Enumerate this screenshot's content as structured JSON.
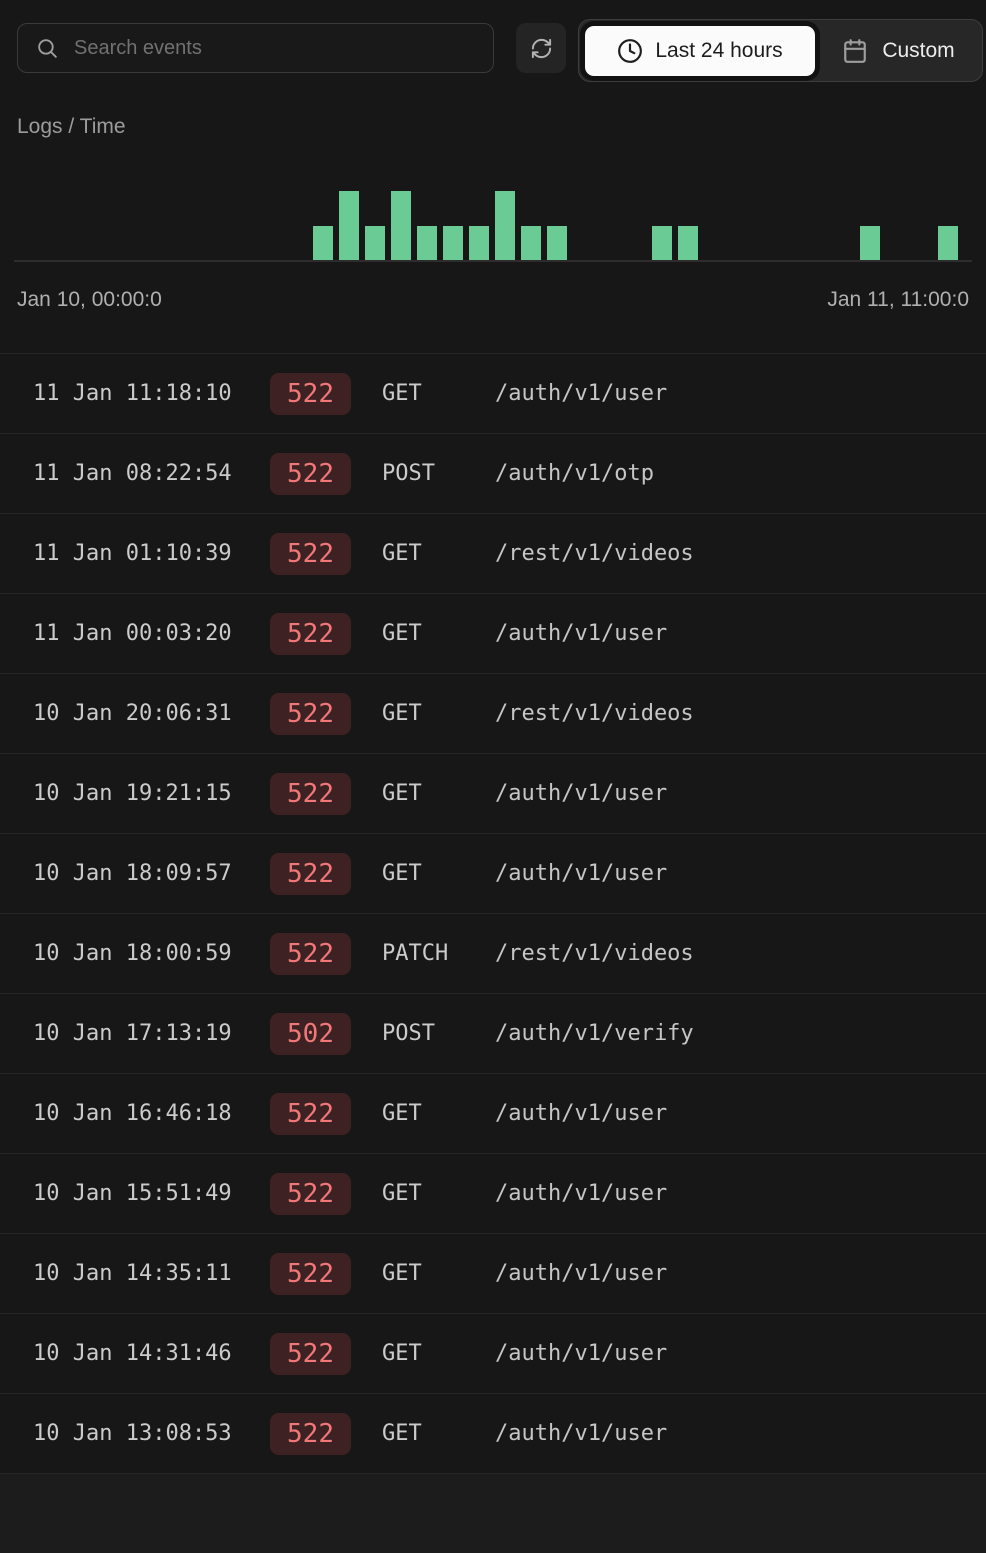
{
  "header": {
    "search": {
      "placeholder": "Search events",
      "value": "",
      "icon": "search-icon"
    },
    "refresh": {
      "icon": "refresh-icon"
    },
    "time_range": {
      "selected": {
        "label": "Last 24 hours",
        "icon": "clock-icon"
      },
      "custom": {
        "label": "Custom",
        "icon": "calendar-icon"
      }
    }
  },
  "chart": {
    "title": "Logs / Time",
    "x_start_label": "Jan 10, 00:00:0",
    "x_end_label": "Jan 11, 11:00:0"
  },
  "chart_data": {
    "type": "bar",
    "title": "Logs / Time",
    "bucket": "1 hour",
    "xlabel": "Time",
    "ylabel": "Logs",
    "ylim": [
      0,
      2
    ],
    "grid": false,
    "bar_color": "#6bcb95",
    "x_axis_labels": [
      "Jan 10, 00:00:0",
      "Jan 11, 11:00:0"
    ],
    "categories": [
      "Jan 10 00:00",
      "Jan 10 01:00",
      "Jan 10 02:00",
      "Jan 10 03:00",
      "Jan 10 04:00",
      "Jan 10 05:00",
      "Jan 10 06:00",
      "Jan 10 07:00",
      "Jan 10 08:00",
      "Jan 10 09:00",
      "Jan 10 10:00",
      "Jan 10 11:00",
      "Jan 10 12:00",
      "Jan 10 13:00",
      "Jan 10 14:00",
      "Jan 10 15:00",
      "Jan 10 16:00",
      "Jan 10 17:00",
      "Jan 10 18:00",
      "Jan 10 19:00",
      "Jan 10 20:00",
      "Jan 10 21:00",
      "Jan 10 22:00",
      "Jan 10 23:00",
      "Jan 11 00:00",
      "Jan 11 01:00",
      "Jan 11 02:00",
      "Jan 11 03:00",
      "Jan 11 04:00",
      "Jan 11 05:00",
      "Jan 11 06:00",
      "Jan 11 07:00",
      "Jan 11 08:00",
      "Jan 11 09:00",
      "Jan 11 10:00",
      "Jan 11 11:00"
    ],
    "values": [
      0,
      0,
      0,
      0,
      0,
      0,
      0,
      0,
      0,
      0,
      0,
      1,
      2,
      1,
      2,
      1,
      1,
      1,
      2,
      1,
      1,
      0,
      0,
      0,
      1,
      1,
      0,
      0,
      0,
      0,
      0,
      0,
      1,
      0,
      0,
      1
    ]
  },
  "table": {
    "rows": [
      {
        "timestamp": "11 Jan 11:18:10",
        "status": "522",
        "method": "GET",
        "path": "/auth/v1/user"
      },
      {
        "timestamp": "11 Jan 08:22:54",
        "status": "522",
        "method": "POST",
        "path": "/auth/v1/otp"
      },
      {
        "timestamp": "11 Jan 01:10:39",
        "status": "522",
        "method": "GET",
        "path": "/rest/v1/videos"
      },
      {
        "timestamp": "11 Jan 00:03:20",
        "status": "522",
        "method": "GET",
        "path": "/auth/v1/user"
      },
      {
        "timestamp": "10 Jan 20:06:31",
        "status": "522",
        "method": "GET",
        "path": "/rest/v1/videos"
      },
      {
        "timestamp": "10 Jan 19:21:15",
        "status": "522",
        "method": "GET",
        "path": "/auth/v1/user"
      },
      {
        "timestamp": "10 Jan 18:09:57",
        "status": "522",
        "method": "GET",
        "path": "/auth/v1/user"
      },
      {
        "timestamp": "10 Jan 18:00:59",
        "status": "522",
        "method": "PATCH",
        "path": "/rest/v1/videos"
      },
      {
        "timestamp": "10 Jan 17:13:19",
        "status": "502",
        "method": "POST",
        "path": "/auth/v1/verify"
      },
      {
        "timestamp": "10 Jan 16:46:18",
        "status": "522",
        "method": "GET",
        "path": "/auth/v1/user"
      },
      {
        "timestamp": "10 Jan 15:51:49",
        "status": "522",
        "method": "GET",
        "path": "/auth/v1/user"
      },
      {
        "timestamp": "10 Jan 14:35:11",
        "status": "522",
        "method": "GET",
        "path": "/auth/v1/user"
      },
      {
        "timestamp": "10 Jan 14:31:46",
        "status": "522",
        "method": "GET",
        "path": "/auth/v1/user"
      },
      {
        "timestamp": "10 Jan 13:08:53",
        "status": "522",
        "method": "GET",
        "path": "/auth/v1/user"
      }
    ]
  },
  "colors": {
    "accent_green": "#6bcb95",
    "badge_bg": "#3e2223",
    "badge_text": "#f17878",
    "selected_range_bg": "#fbfbfb",
    "page_bg": "#171717"
  }
}
